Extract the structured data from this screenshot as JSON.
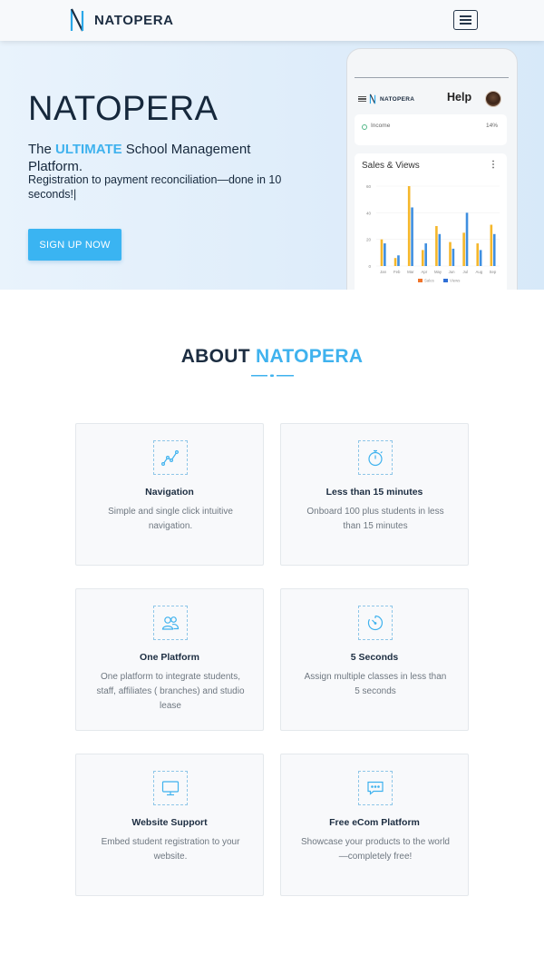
{
  "navbar": {
    "brand": "NATOPERA"
  },
  "hero": {
    "title": "NATOPERA",
    "tagline_pre": "The ",
    "tagline_highlight": "ULTIMATE",
    "tagline_post": " School Management Platform.",
    "subtitle": "Registration to payment reconciliation—done in 10 seconds!|",
    "signup_label": "SIGN UP NOW"
  },
  "phone": {
    "brand": "NATOPERA",
    "help": "Help",
    "income_label": "Income",
    "income_value": "14%",
    "chart_title": "Sales & Views",
    "chart_menu": "⋮"
  },
  "chart_data": {
    "type": "bar",
    "title": "Sales & Views",
    "categories": [
      "Jan",
      "Feb",
      "Mar",
      "Apr",
      "May",
      "Jun",
      "Jul",
      "Aug",
      "Sep"
    ],
    "ylim": [
      0,
      60
    ],
    "yticks": [
      0,
      20,
      40,
      60
    ],
    "series": [
      {
        "name": "Sales",
        "values": [
          20,
          6,
          60,
          12,
          30,
          18,
          25,
          17,
          31
        ]
      },
      {
        "name": "Views",
        "values": [
          17,
          8,
          44,
          17,
          24,
          13,
          40,
          12,
          24
        ]
      }
    ],
    "colors": {
      "Sales": "#f5b72b",
      "Views": "#3f8fe0"
    },
    "legend_colors": {
      "Sales": "#f0742a",
      "Views": "#2f6fd6"
    }
  },
  "about": {
    "title_pre": "ABOUT ",
    "title_highlight": "NATOPERA",
    "cards": [
      {
        "icon": "chart-line-icon",
        "title": "Navigation",
        "desc": "Simple and single click intuitive navigation."
      },
      {
        "icon": "stopwatch-icon",
        "title": "Less than 15 minutes",
        "desc": "Onboard 100 plus students in less than 15 minutes"
      },
      {
        "icon": "users-icon",
        "title": "One Platform",
        "desc": "One platform to integrate students, staff, affiliates ( branches) and studio lease"
      },
      {
        "icon": "timer-icon",
        "title": "5 Seconds",
        "desc": "Assign multiple classes in less than 5 seconds"
      },
      {
        "icon": "monitor-icon",
        "title": "Website Support",
        "desc": "Embed student registration to your website."
      },
      {
        "icon": "chat-icon",
        "title": "Free eCom Platform",
        "desc": "Showcase your products to the world —completely free!"
      }
    ]
  },
  "colors": {
    "accent": "#3fb2ee",
    "dark": "#1c2d41",
    "button": "#3ab4f2"
  }
}
